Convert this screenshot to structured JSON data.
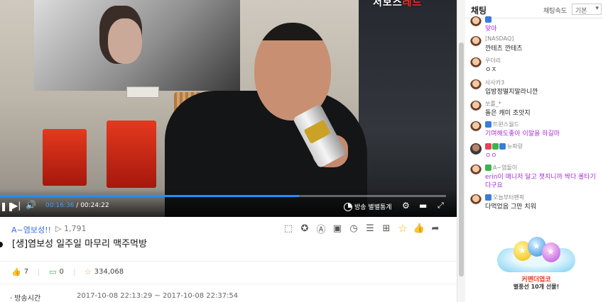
{
  "video": {
    "overlay_text_white": "서보스",
    "overlay_text_red": "레드",
    "current_time": "00:16:36",
    "total_time": "/ 00:24:22",
    "progress_fraction": 0.67,
    "stats_button_label": "방송 별별통계"
  },
  "info": {
    "uploader": "A~염보성!!",
    "view_icon": "▷",
    "views": "1,791",
    "title": "[생]염보성 일주일 마무리 맥주먹방",
    "likes": "7",
    "comments": "0",
    "favorites": "334,068",
    "broadcast_time_label": "· 방송시간",
    "broadcast_time_value": "2017-10-08 22:13:29 ~ 2017-10-08 22:37:54"
  },
  "chat": {
    "title": "채팅",
    "speed_label": "채팅속도",
    "speed_value": "기본",
    "messages": [
      {
        "nick": "",
        "text": "맞아",
        "purple": true
      },
      {
        "nick": "[NASDAQ]",
        "text": "깐테츠 깐테츠",
        "purple": false
      },
      {
        "nick": "우더리",
        "text": "ㅇㅈ",
        "purple": false
      },
      {
        "nick": "사사카3",
        "text": "입방정떨지말라니깐",
        "purple": false
      },
      {
        "nick": "쏘롤_*",
        "text": "돌은 캐미 조앗지",
        "purple": false
      },
      {
        "nick": "트윈스월드",
        "text": "기며해도좋아 이말을 하길마",
        "purple": true
      },
      {
        "nick": "뉴파랑",
        "text": "ㅇㅇ",
        "purple": true
      },
      {
        "nick": "A~염둘이",
        "text": "erin이 매니저 달고 챗치니까 쌱다 롤타기",
        "text2": "다구요",
        "purple": true
      },
      {
        "nick": "오늘부터팬픽",
        "text": "다먹었음 그만 치워",
        "purple": false
      }
    ],
    "gift_name": "커맨더엽코",
    "gift_message": "별풍선 10개 선물!"
  },
  "colors": {
    "accent_blue": "#3aa0ff",
    "chat_purple": "#a52cd6",
    "favorite_star": "#f0b400"
  }
}
